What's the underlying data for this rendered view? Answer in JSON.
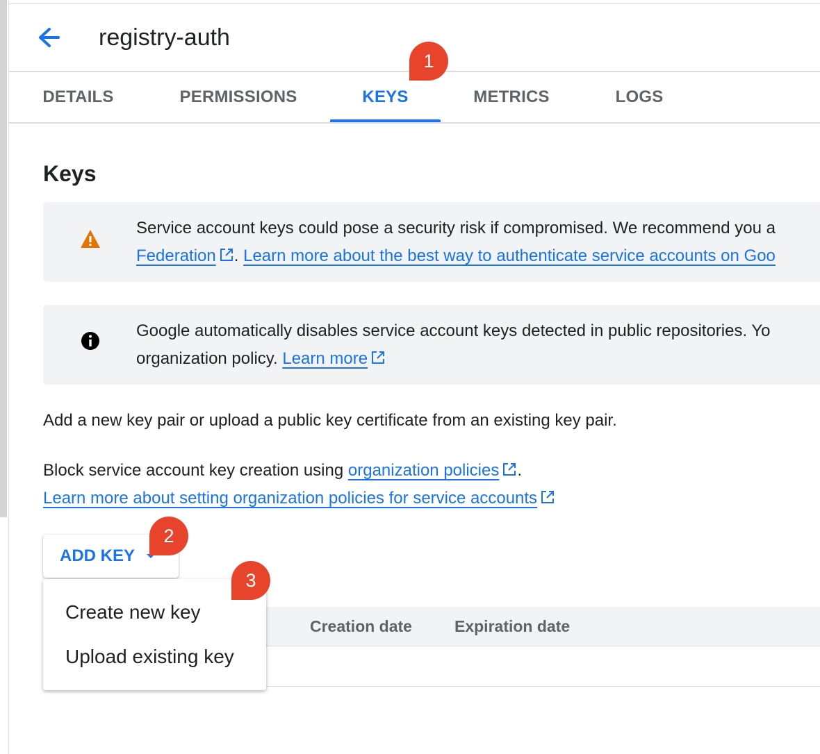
{
  "header": {
    "title": "registry-auth",
    "back_icon": "arrow-left-icon"
  },
  "tabs": [
    {
      "label": "DETAILS",
      "active": false
    },
    {
      "label": "PERMISSIONS",
      "active": false
    },
    {
      "label": "KEYS",
      "active": true
    },
    {
      "label": "METRICS",
      "active": false
    },
    {
      "label": "LOGS",
      "active": false
    }
  ],
  "callouts": [
    "1",
    "2",
    "3"
  ],
  "section": {
    "title": "Keys"
  },
  "warning_banner": {
    "icon": "warning-icon",
    "line1": "Service account keys could pose a security risk if compromised. We recommend you a",
    "link1": "Federation",
    "sep": ". ",
    "link2": "Learn more about the best way to authenticate service accounts on Goo"
  },
  "info_banner": {
    "icon": "info-icon",
    "line1": "Google automatically disables service account keys detected in public repositories. Yo",
    "line2": "organization policy. ",
    "link": "Learn more"
  },
  "body": {
    "para1": "Add a new key pair or upload a public key certificate from an existing key pair.",
    "para2_prefix": "Block service account key creation using ",
    "para2_link": "organization policies",
    "para2_suffix": ".",
    "para3_link": "Learn more about setting organization policies for service accounts"
  },
  "add_key": {
    "label": "ADD KEY"
  },
  "menu": {
    "items": [
      "Create new key",
      "Upload existing key"
    ]
  },
  "table": {
    "columns": [
      "Creation date",
      "Expiration date"
    ]
  },
  "colors": {
    "accent": "#1a73e8",
    "callout": "#e8442c",
    "warning": "#e37400",
    "banner_bg": "#f1f3f4"
  }
}
